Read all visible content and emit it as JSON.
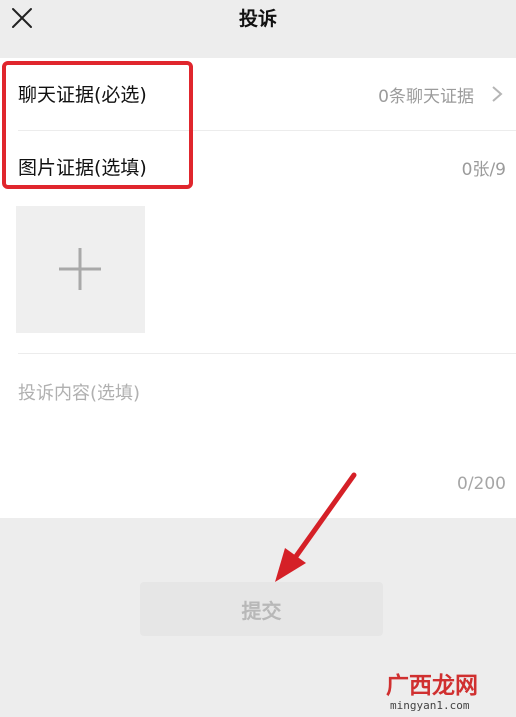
{
  "header": {
    "title": "投诉"
  },
  "evidence": {
    "chat_label": "聊天证据(必选)",
    "chat_value": "0条聊天证据",
    "image_label": "图片证据(选填)",
    "image_count": "0张/9"
  },
  "content": {
    "placeholder": "投诉内容(选填)",
    "counter": "0/200"
  },
  "submit": {
    "label": "提交"
  },
  "watermark": {
    "text": "广西龙网",
    "url": "mingyan1.com"
  },
  "colors": {
    "highlight": "#e0262d",
    "arrow": "#d52027"
  }
}
